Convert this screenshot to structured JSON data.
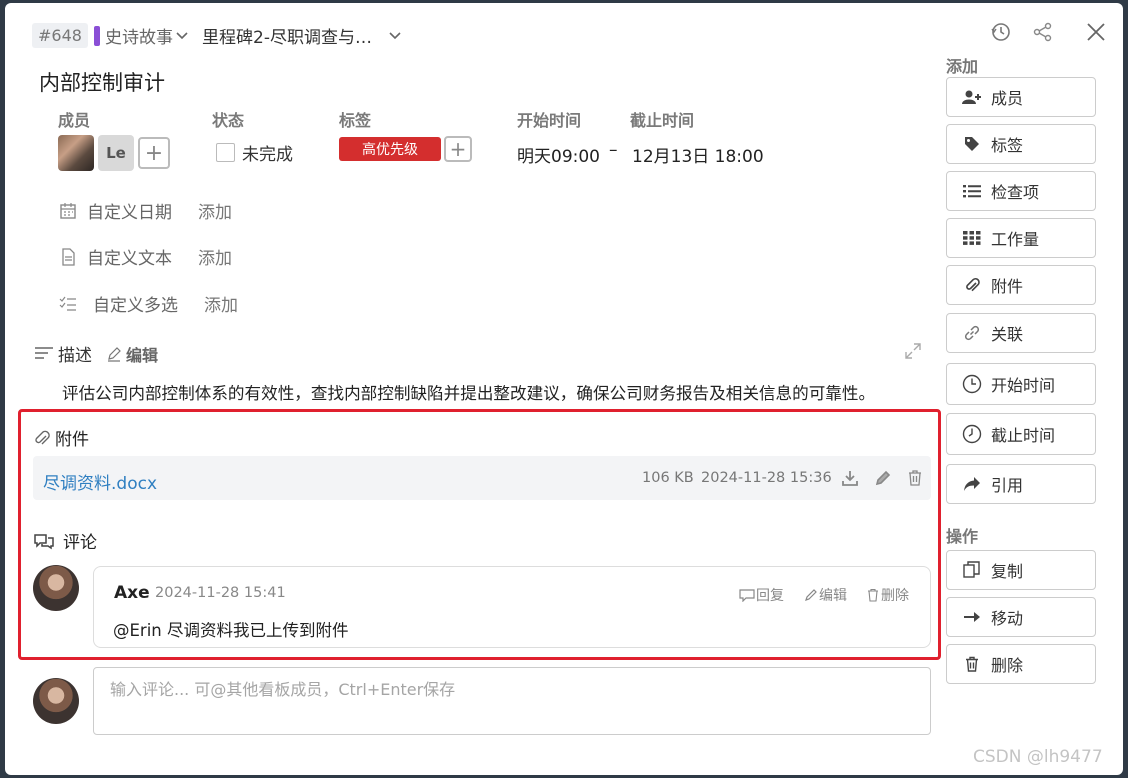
{
  "header": {
    "task_id": "#648",
    "epic_label": "史诗故事",
    "milestone": "里程碑2-尽职调查与…",
    "title": "内部控制审计"
  },
  "fields": {
    "members_label": "成员",
    "member_initials": "Le",
    "status_label": "状态",
    "status_value": "未完成",
    "tags_label": "标签",
    "tag_value": "高优先级",
    "tag_color": "#d42e2e",
    "start_label": "开始时间",
    "start_value": "明天09:00",
    "date_sep": "–",
    "end_label": "截止时间",
    "end_value": "12月13日 18:00"
  },
  "custom": [
    {
      "label": "自定义日期",
      "add": "添加"
    },
    {
      "label": "自定义文本",
      "add": "添加"
    },
    {
      "label": "自定义多选",
      "add": "添加"
    }
  ],
  "description": {
    "label": "描述",
    "edit": "编辑",
    "text": "评估公司内部控制体系的有效性，查找内部控制缺陷并提出整改建议，确保公司财务报告及相关信息的可靠性。"
  },
  "attachments": {
    "label": "附件",
    "file_name": "尽调资料.docx",
    "file_size": "106 KB",
    "file_time": "2024-11-28 15:36"
  },
  "comments": {
    "label": "评论",
    "author": "Axe",
    "time": "2024-11-28 15:41",
    "reply": "回复",
    "edit": "编辑",
    "delete": "删除",
    "text": "@Erin 尽调资料我已上传到附件",
    "input_placeholder": "输入评论... 可@其他看板成员，Ctrl+Enter保存"
  },
  "sidebar": {
    "add_head": "添加",
    "add_items": [
      "成员",
      "标签",
      "检查项",
      "工作量",
      "附件",
      "关联",
      "开始时间",
      "截止时间",
      "引用"
    ],
    "ops_head": "操作",
    "ops_items": [
      "复制",
      "移动",
      "删除"
    ]
  },
  "watermark": "CSDN @lh9477",
  "colors": {
    "accent_link": "#2f7fc1",
    "epic_purple": "#8a4fd6",
    "highlight_box": "#e0202e"
  }
}
